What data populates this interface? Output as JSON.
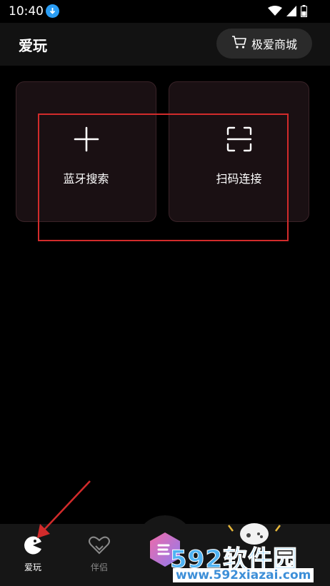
{
  "status_bar": {
    "time": "10:40",
    "icons": [
      "download-icon",
      "wifi-icon",
      "signal-icon",
      "battery-icon"
    ]
  },
  "header": {
    "title": "爱玩",
    "mall_button": "极爱商城",
    "mall_icon": "cart-icon"
  },
  "cards": [
    {
      "label": "蓝牙搜索",
      "icon": "plus-icon"
    },
    {
      "label": "扫码连接",
      "icon": "scan-icon"
    }
  ],
  "bottom_nav": {
    "items": [
      {
        "label": "爱玩",
        "icon": "pacman-icon",
        "active": true
      },
      {
        "label": "伴侣",
        "icon": "double-heart-icon",
        "active": false
      }
    ]
  },
  "watermark": {
    "logo": "592软件园",
    "url": "www.592xiazai.com"
  },
  "colors": {
    "background": "#000000",
    "header": "#121212",
    "card": "#1a1013",
    "card_border": "#3a2328",
    "annotation": "#d22b2b",
    "download_badge": "#2a9df4"
  }
}
